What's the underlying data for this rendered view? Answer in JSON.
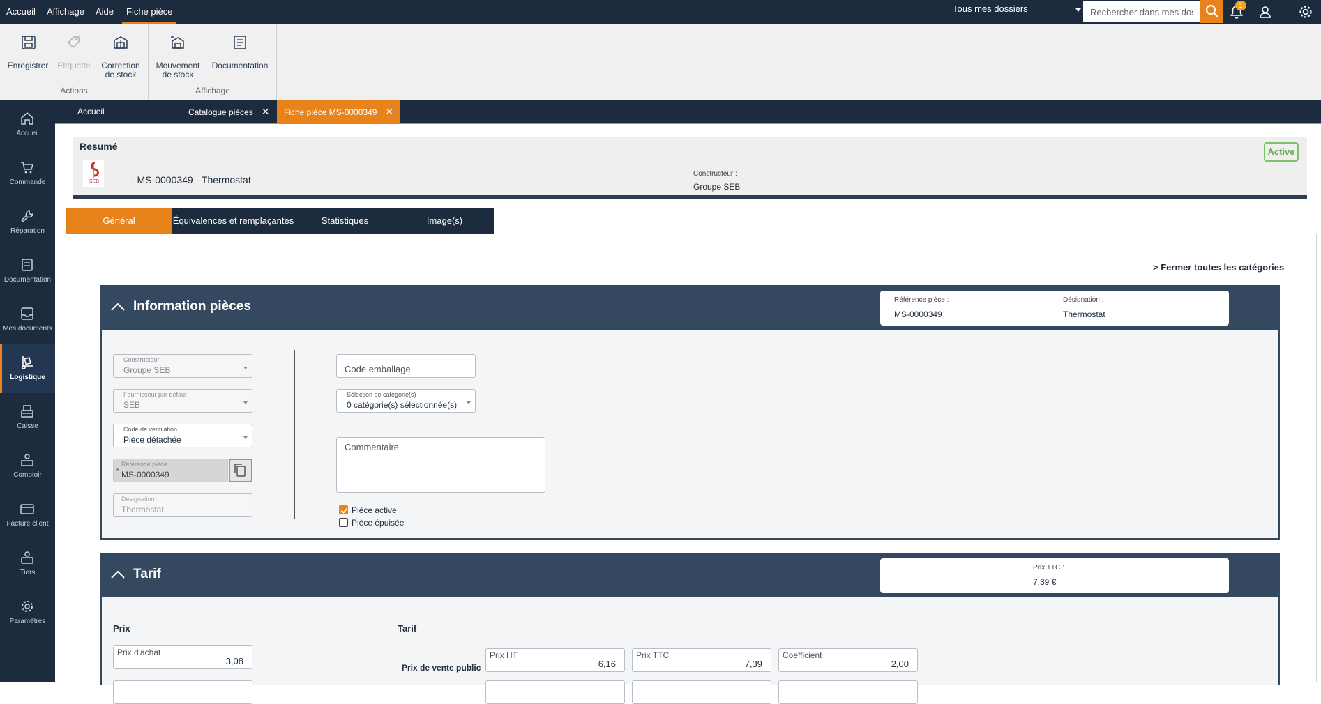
{
  "topbar": {
    "menu": [
      "Accueil",
      "Affichage",
      "Aide",
      "Fiche pièce"
    ],
    "dossier_select": "Tous mes dossiers",
    "search_placeholder": "Rechercher dans mes dossiers",
    "notification_count": "1"
  },
  "ribbon": {
    "save": "Enregistrer",
    "label": "Etiquette",
    "stock_correction_1": "Correction",
    "stock_correction_2": "de stock",
    "stock_move_1": "Mouvement",
    "stock_move_2": "de stock",
    "documentation": "Documentation",
    "group_actions": "Actions",
    "group_display": "Affichage"
  },
  "sidenav": [
    "Accueil",
    "Commande",
    "Réparation",
    "Documentation",
    "Mes documents",
    "Logistique",
    "Caisse",
    "Comptoir",
    "Facture client",
    "Tiers",
    "Paramètres"
  ],
  "doc_tabs": [
    "Accueil",
    "Catalogue pièces",
    "Fiche pièce MS-0000349"
  ],
  "resume": {
    "title": "Resumé",
    "logo_text": "SEB",
    "part_title": "- MS-0000349 - Thermostat",
    "constructor_label": "Constructeur :",
    "constructor_value": "Groupe SEB",
    "status": "Active"
  },
  "sub_tabs": [
    "Général",
    "Équivalences et remplaçantes",
    "Statistiques",
    "Image(s)"
  ],
  "close_all": "Fermer toutes les catégories",
  "info": {
    "title": "Information pièces",
    "ref_label": "Référence pièce :",
    "ref_value": "MS-0000349",
    "desig_label": "Désignation :",
    "desig_value": "Thermostat",
    "constructeur_label": "Constructeur",
    "constructeur_value": "Groupe SEB",
    "fournisseur_label": "Fournisseur par défaut",
    "fournisseur_value": "SEB",
    "ventilation_label": "Code de ventilation",
    "ventilation_value": "Pièce détachée",
    "reference_label": "Référence pièce",
    "reference_value": "MS-0000349",
    "designation_label": "Désignation",
    "designation_value": "Thermostat",
    "code_emballage_placeholder": "Code emballage",
    "categorie_label": "Sélection de catégorie(s)",
    "categorie_value": "0 catégorie(s) sélectionnée(s)",
    "commentaire_placeholder": "Commentaire",
    "piece_active": "Pièce active",
    "piece_epuisee": "Pièce épuisée",
    "piece_active_checked": true,
    "piece_epuisee_checked": false
  },
  "tarif": {
    "title": "Tarif",
    "ttc_label": "Prix TTC :",
    "ttc_value": "7,39 €",
    "prix_heading": "Prix",
    "tarif_heading": "Tarif",
    "prix_achat_label": "Prix d'achat",
    "prix_achat_value": "3,08",
    "pvp_label": "Prix de vente public",
    "ht_label": "Prix HT",
    "ht_value": "6,16",
    "ttc_field_label": "Prix TTC",
    "ttc_field_value": "7,39",
    "coef_label": "Coefficient",
    "coef_value": "2,00"
  }
}
